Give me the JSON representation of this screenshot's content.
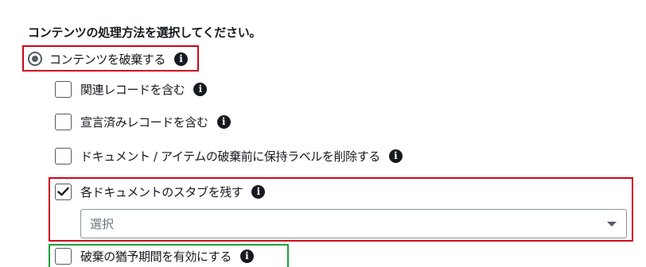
{
  "heading": "コンテンツの処理方法を選択してください。",
  "radio_option": {
    "label": "コンテンツを破棄する",
    "selected": true
  },
  "options": [
    {
      "label": "関連レコードを含む",
      "checked": false
    },
    {
      "label": "宣言済みレコードを含む",
      "checked": false
    },
    {
      "label": "ドキュメント / アイテムの破棄前に保持ラベルを削除する",
      "checked": false
    },
    {
      "label": "各ドキュメントのスタブを残す",
      "checked": true
    },
    {
      "label": "破棄の猶予期間を有効にする",
      "checked": false
    }
  ],
  "stub_select": {
    "value": "選択"
  },
  "icons": {
    "info": "info-icon",
    "check": "check-icon",
    "dropdown": "chevron-down-icon"
  },
  "colors": {
    "highlight_red": "#d0021b",
    "highlight_green": "#1e9e3a"
  }
}
